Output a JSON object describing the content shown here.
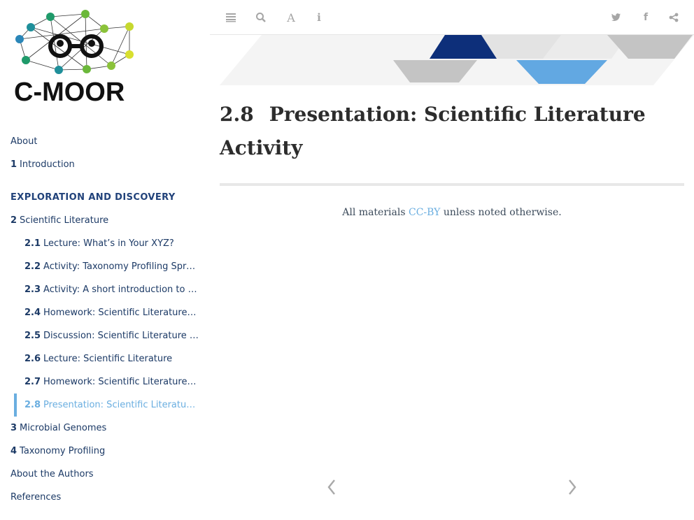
{
  "logo": {
    "text": "C-MOOR"
  },
  "sidebar": {
    "items": [
      {
        "kind": "link",
        "level": 0,
        "num": "",
        "label": "About"
      },
      {
        "kind": "link",
        "level": 0,
        "num": "1",
        "label": "Introduction"
      },
      {
        "kind": "header",
        "level": 0,
        "num": "",
        "label": "EXPLORATION AND DISCOVERY"
      },
      {
        "kind": "link",
        "level": 0,
        "num": "2",
        "label": "Scientific Literature"
      },
      {
        "kind": "link",
        "level": 1,
        "num": "2.1",
        "label": "Lecture: What’s in Your XYZ?"
      },
      {
        "kind": "link",
        "level": 1,
        "num": "2.2",
        "label": "Activity: Taxonomy Profiling Spre…"
      },
      {
        "kind": "link",
        "level": 1,
        "num": "2.3",
        "label": "Activity: A short introduction to G…"
      },
      {
        "kind": "link",
        "level": 1,
        "num": "2.4",
        "label": "Homework: Scientific Literature P…"
      },
      {
        "kind": "link",
        "level": 1,
        "num": "2.5",
        "label": "Discussion: Scientific Literature P…"
      },
      {
        "kind": "link",
        "level": 1,
        "num": "2.6",
        "label": "Lecture: Scientific Literature"
      },
      {
        "kind": "link",
        "level": 1,
        "num": "2.7",
        "label": "Homework: Scientific Literature A…"
      },
      {
        "kind": "link",
        "level": 1,
        "num": "2.8",
        "label": "Presentation: Scientific Literature…",
        "active": true
      },
      {
        "kind": "link",
        "level": 0,
        "num": "3",
        "label": "Microbial Genomes"
      },
      {
        "kind": "link",
        "level": 0,
        "num": "4",
        "label": "Taxonomy Profiling"
      },
      {
        "kind": "link",
        "level": 0,
        "num": "",
        "label": "About the Authors"
      },
      {
        "kind": "link",
        "level": 0,
        "num": "",
        "label": "References"
      }
    ]
  },
  "toolbar": {
    "left": [
      "toc-toggle-icon",
      "search-icon",
      "font-settings-icon",
      "info-icon"
    ],
    "right": [
      "twitter-icon",
      "facebook-icon",
      "share-icon"
    ]
  },
  "page": {
    "section_number": "2.8",
    "title": "Presentation: Scientific Literature Activity",
    "license_prefix": "All materials ",
    "license_link": "CC-BY",
    "license_suffix": " unless noted otherwise."
  },
  "navigation": {
    "prev_icon": "chevron-left-icon",
    "next_icon": "chevron-right-icon"
  },
  "colors": {
    "accent": "#6aaee0",
    "navy": "#0d2f7a",
    "nav_text": "#1c3a66"
  }
}
